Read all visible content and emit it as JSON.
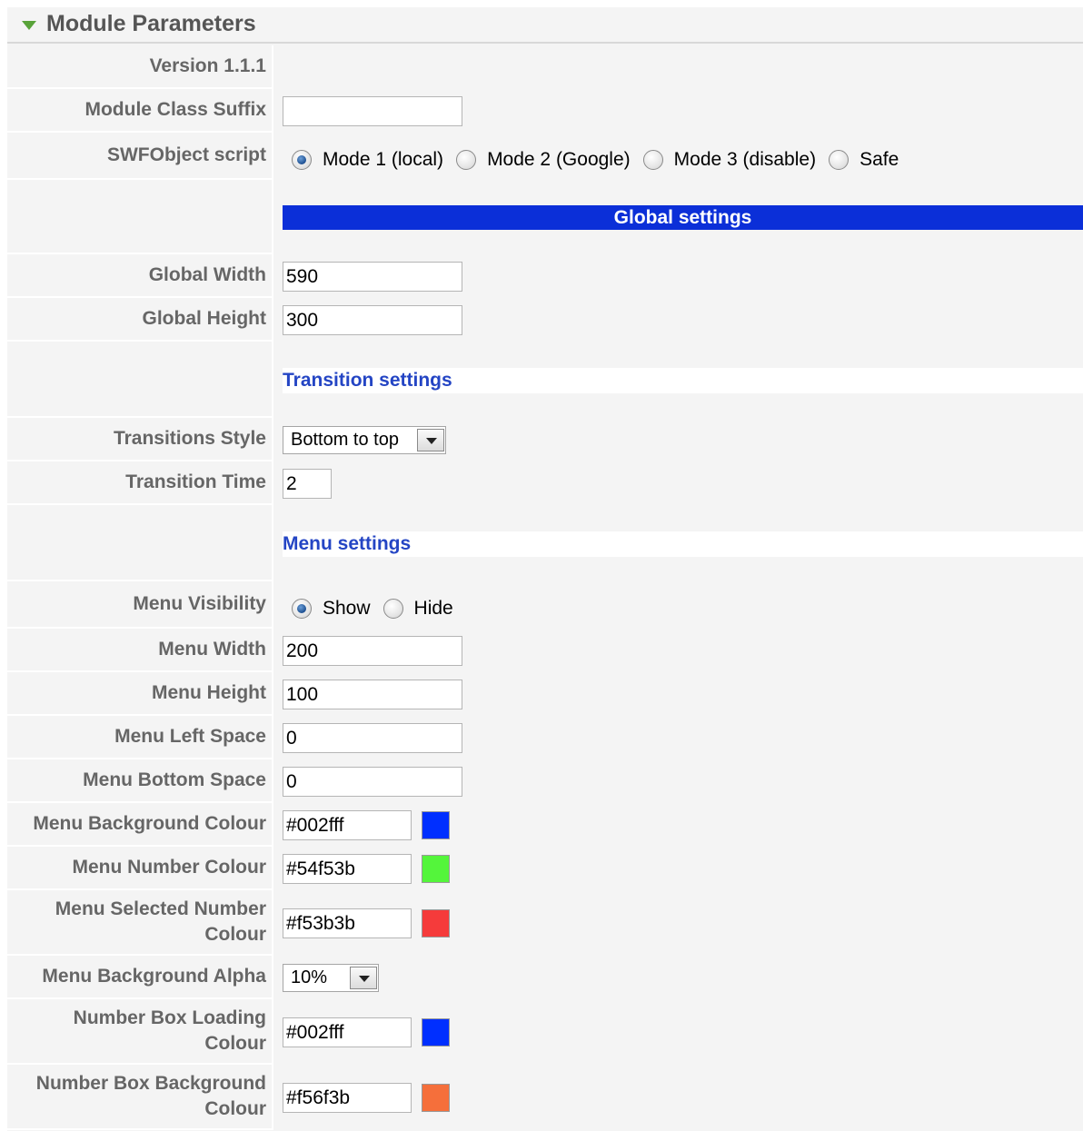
{
  "header": {
    "title": "Module Parameters"
  },
  "version_label": "Version 1.1.1",
  "fields": {
    "module_class_suffix": {
      "label": "Module Class Suffix",
      "value": ""
    },
    "swfobject": {
      "label": "SWFObject script",
      "options": [
        "Mode 1 (local)",
        "Mode 2 (Google)",
        "Mode 3 (disable)",
        "Safe"
      ],
      "selected": "Mode 1 (local)"
    },
    "global_width": {
      "label": "Global Width",
      "value": "590"
    },
    "global_height": {
      "label": "Global Height",
      "value": "300"
    },
    "transitions_style": {
      "label": "Transitions Style",
      "value": "Bottom to top"
    },
    "transition_time": {
      "label": "Transition Time",
      "value": "2"
    },
    "menu_visibility": {
      "label": "Menu Visibility",
      "options": [
        "Show",
        "Hide"
      ],
      "selected": "Show"
    },
    "menu_width": {
      "label": "Menu Width",
      "value": "200"
    },
    "menu_height": {
      "label": "Menu Height",
      "value": "100"
    },
    "menu_left_space": {
      "label": "Menu Left Space",
      "value": "0"
    },
    "menu_bottom_space": {
      "label": "Menu Bottom Space",
      "value": "0"
    },
    "menu_background_colour": {
      "label": "Menu Background Colour",
      "value": "#002fff",
      "color": "#002fff"
    },
    "menu_number_colour": {
      "label": "Menu Number Colour",
      "value": "#54f53b",
      "color": "#54f53b"
    },
    "menu_selected_number_colour": {
      "label_line1": "Menu Selected Number",
      "label_line2": "Colour",
      "value": "#f53b3b",
      "color": "#f53b3b"
    },
    "menu_background_alpha": {
      "label": "Menu Background Alpha",
      "value": "10%"
    },
    "number_box_loading_colour": {
      "label_line1": "Number Box Loading",
      "label_line2": "Colour",
      "value": "#002fff",
      "color": "#002fff"
    },
    "number_box_background_colour": {
      "label_line1": "Number Box Background",
      "label_line2": "Colour",
      "value": "#f56f3b",
      "color": "#f56f3b"
    }
  },
  "sections": {
    "global": "Global settings",
    "transition": "Transition settings",
    "menu": "Menu settings"
  }
}
